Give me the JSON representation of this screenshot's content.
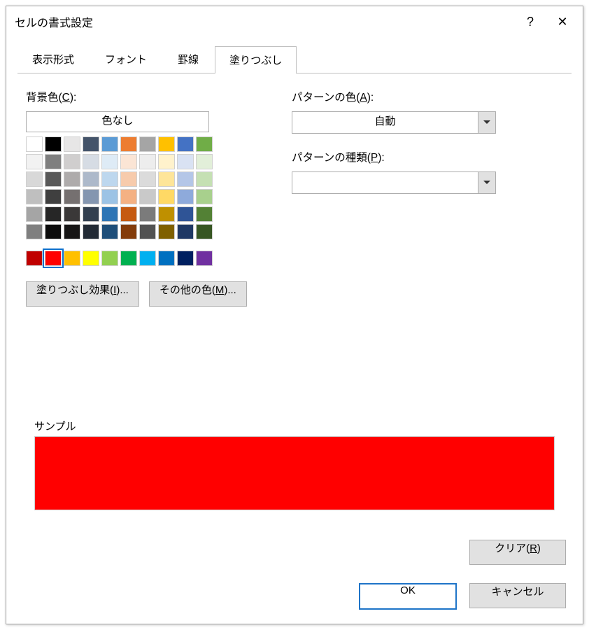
{
  "titlebar": {
    "title": "セルの書式設定",
    "help": "?",
    "close": "✕"
  },
  "tabs": [
    {
      "label": "表示形式"
    },
    {
      "label": "フォント"
    },
    {
      "label": "罫線"
    },
    {
      "label": "塗りつぶし",
      "active": true
    }
  ],
  "left": {
    "label_pre": "背景色(",
    "label_key": "C",
    "label_post": "):",
    "nocolor": "色なし",
    "fill_button_pre": "塗りつぶし効果(",
    "fill_button_key": "I",
    "fill_button_post": ")...",
    "more_button_pre": "その他の色(",
    "more_button_key": "M",
    "more_button_post": ")..."
  },
  "right": {
    "pattern_color_pre": "パターンの色(",
    "pattern_color_key": "A",
    "pattern_color_post": "):",
    "pattern_color_value": "自動",
    "pattern_type_pre": "パターンの種類(",
    "pattern_type_key": "P",
    "pattern_type_post": "):",
    "pattern_type_value": ""
  },
  "palette_rows": {
    "row1": [
      "#ffffff",
      "#000000",
      "#e7e6e6",
      "#44546a",
      "#5b9bd5",
      "#ed7d31",
      "#a5a5a5",
      "#ffc000",
      "#4472c4",
      "#70ad47"
    ],
    "row2": [
      "#f2f2f2",
      "#7f7f7f",
      "#d0cece",
      "#d6dce4",
      "#deebf6",
      "#fbe5d5",
      "#ededed",
      "#fff2cc",
      "#d9e2f3",
      "#e2efd9"
    ],
    "row3": [
      "#d8d8d8",
      "#595959",
      "#aeabab",
      "#adb9ca",
      "#bdd7ee",
      "#f7cbac",
      "#dbdbdb",
      "#fee599",
      "#b4c6e7",
      "#c5e0b3"
    ],
    "row4": [
      "#bfbfbf",
      "#3f3f3f",
      "#757070",
      "#8496b0",
      "#9cc3e5",
      "#f4b183",
      "#c9c9c9",
      "#ffd965",
      "#8eaadb",
      "#a8d08d"
    ],
    "row5": [
      "#a5a5a5",
      "#262626",
      "#3a3838",
      "#323f4f",
      "#2e75b5",
      "#c55a11",
      "#7b7b7b",
      "#bf9000",
      "#2f5496",
      "#538135"
    ],
    "row6": [
      "#7f7f7f",
      "#0c0c0c",
      "#171616",
      "#222a35",
      "#1e4e79",
      "#833c0b",
      "#525252",
      "#7f6000",
      "#1f3864",
      "#375623"
    ],
    "standard": [
      "#c00000",
      "#ff0000",
      "#ffc000",
      "#ffff00",
      "#92d050",
      "#00b050",
      "#00b0f0",
      "#0070c0",
      "#002060",
      "#7030a0"
    ],
    "selected": "#ff0000"
  },
  "sample": {
    "label": "サンプル",
    "color": "#ff0000"
  },
  "buttons": {
    "clear_pre": "クリア(",
    "clear_key": "R",
    "clear_post": ")",
    "ok": "OK",
    "cancel": "キャンセル"
  }
}
